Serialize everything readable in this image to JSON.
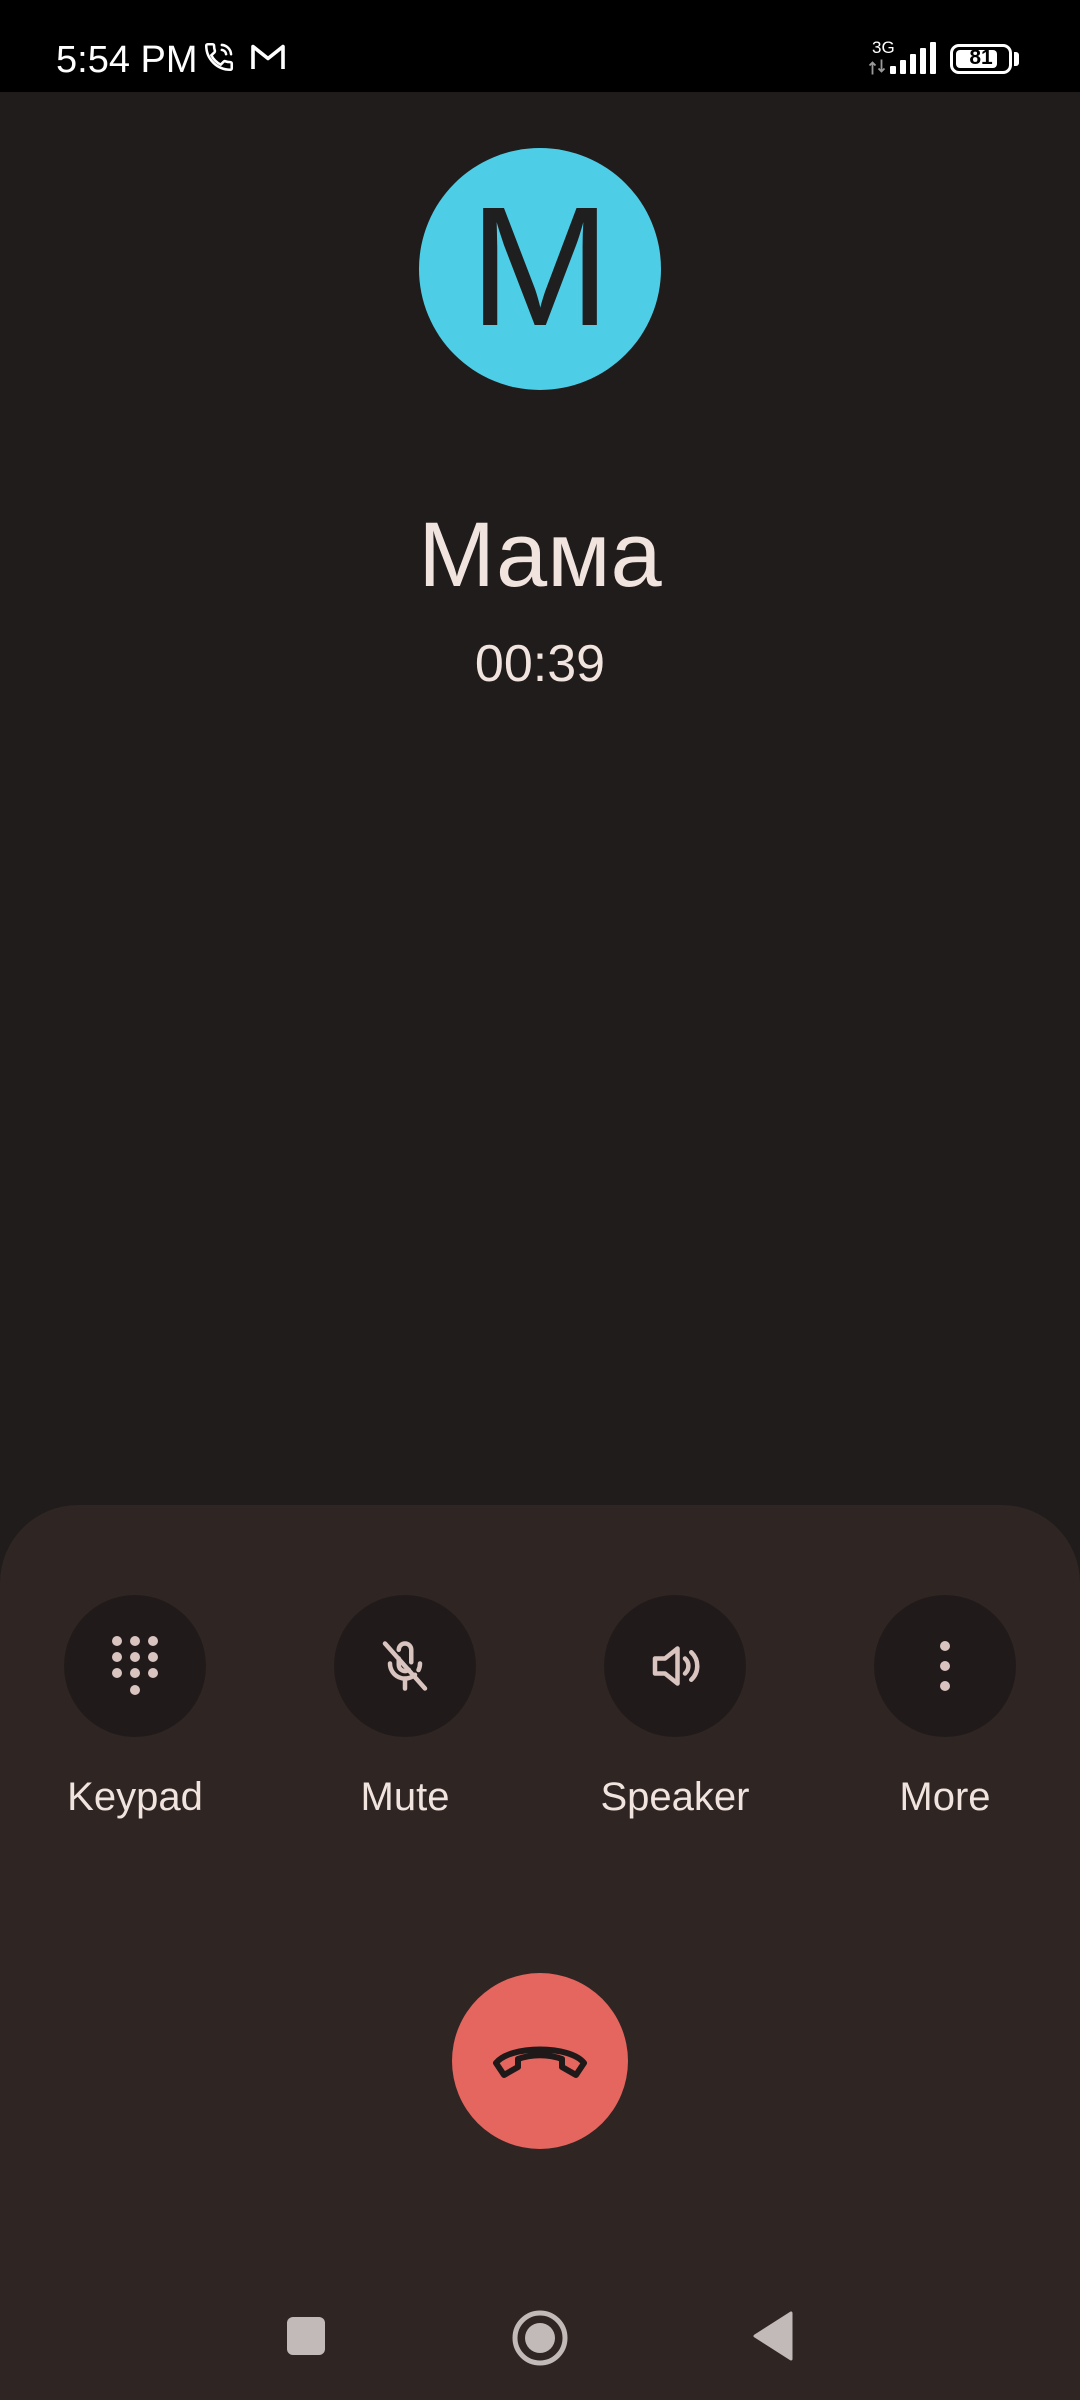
{
  "status_bar": {
    "time": "5:54 PM",
    "network_type": "3G",
    "battery_level": "81",
    "battery_percent": 81,
    "icons": [
      "wifi-calling-icon",
      "gmail-icon",
      "signal-icon",
      "battery-icon"
    ]
  },
  "caller": {
    "avatar_letter": "M",
    "avatar_color": "#4ecde6",
    "name": "Мама",
    "duration": "00:39"
  },
  "controls": {
    "keypad_label": "Keypad",
    "mute_label": "Mute",
    "speaker_label": "Speaker",
    "more_label": "More"
  },
  "end_call": {
    "icon": "call-end-icon",
    "color": "#e5655f"
  },
  "nav_bar": {
    "icons": [
      "recents-icon",
      "home-icon",
      "back-icon"
    ]
  }
}
